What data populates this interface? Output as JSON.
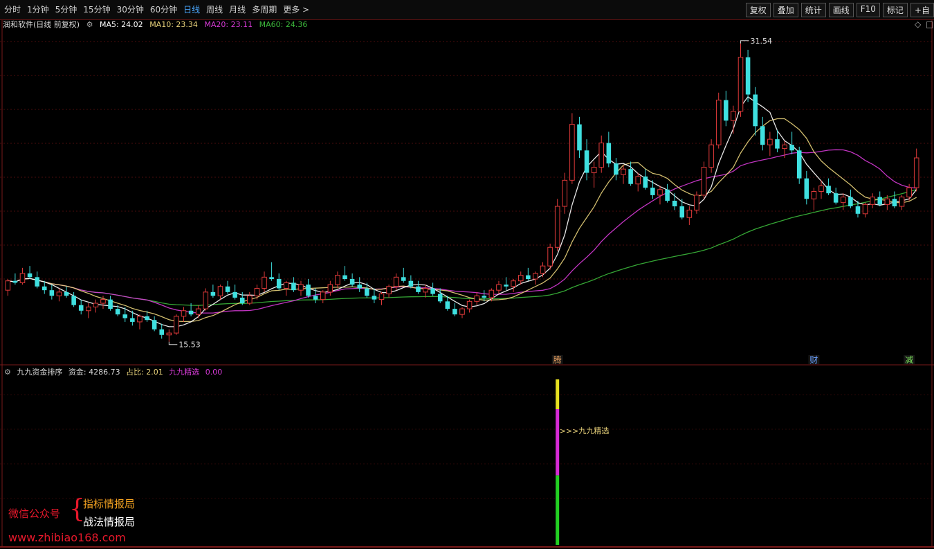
{
  "toolbar": {
    "periods": [
      "分时",
      "1分钟",
      "5分钟",
      "15分钟",
      "30分钟",
      "60分钟",
      "日线",
      "周线",
      "月线",
      "多周期",
      "更多 >"
    ],
    "active_period": "日线",
    "right_buttons": [
      "复权",
      "叠加",
      "统计",
      "画线",
      "F10",
      "标记",
      "+自"
    ]
  },
  "main_info": {
    "title": "润和软件(日线 前复权)",
    "ma5": "MA5: 24.02",
    "ma10": "MA10: 23.34",
    "ma20": "MA20: 23.11",
    "ma60": "MA60: 24.36"
  },
  "annotations": {
    "high": "31.54",
    "low": "15.53"
  },
  "event_markers": [
    {
      "label": "腾",
      "color": "#e8a060"
    },
    {
      "label": "财",
      "color": "#6aa0ff"
    },
    {
      "label": "减",
      "color": "#7adf5a"
    }
  ],
  "sub_info": {
    "name": "九九资金排序",
    "fund": "资金: 4286.73",
    "ratio": "占比: 2.01",
    "pick": "九九精选",
    "pick_value": "0.00"
  },
  "signal_label": ">>>九九精选",
  "watermark": {
    "left": "微信公众号",
    "brace": "{",
    "line1": "指标情报局",
    "line2": "战法情报局",
    "url": "www.zhibiao168.com"
  },
  "colors": {
    "up": "#e03a3a",
    "down": "#3fe0e0",
    "ma5": "#ffffff",
    "ma10": "#e8d27a",
    "ma20": "#d63ad6",
    "ma60": "#3bb83b",
    "grid": "#4a0d0d"
  },
  "chart_data": {
    "type": "candlestick",
    "ohlc": [
      [
        18.3,
        18.9,
        18.0,
        18.8
      ],
      [
        18.8,
        19.2,
        18.6,
        18.7
      ],
      [
        18.7,
        19.5,
        18.6,
        19.2
      ],
      [
        19.2,
        19.6,
        18.9,
        19.0
      ],
      [
        19.0,
        19.3,
        18.4,
        18.5
      ],
      [
        18.5,
        18.8,
        18.1,
        18.3
      ],
      [
        18.3,
        18.6,
        17.8,
        18.0
      ],
      [
        18.0,
        18.4,
        17.7,
        18.2
      ],
      [
        18.2,
        18.5,
        17.9,
        18.0
      ],
      [
        18.0,
        18.2,
        17.4,
        17.5
      ],
      [
        17.5,
        17.8,
        17.0,
        17.2
      ],
      [
        17.2,
        17.6,
        16.8,
        17.4
      ],
      [
        17.4,
        17.8,
        17.1,
        17.6
      ],
      [
        17.6,
        18.0,
        17.3,
        17.8
      ],
      [
        17.8,
        18.0,
        17.2,
        17.3
      ],
      [
        17.3,
        17.5,
        16.9,
        17.0
      ],
      [
        17.0,
        17.4,
        16.6,
        16.8
      ],
      [
        16.8,
        17.2,
        16.4,
        16.6
      ],
      [
        16.6,
        17.0,
        16.2,
        16.9
      ],
      [
        16.9,
        17.2,
        16.6,
        16.7
      ],
      [
        16.7,
        16.9,
        16.1,
        16.2
      ],
      [
        16.2,
        16.5,
        15.7,
        15.9
      ],
      [
        15.9,
        16.2,
        15.53,
        16.0
      ],
      [
        16.0,
        17.0,
        15.9,
        16.9
      ],
      [
        16.9,
        17.4,
        16.6,
        17.2
      ],
      [
        17.2,
        17.6,
        16.9,
        17.0
      ],
      [
        17.0,
        17.5,
        16.8,
        17.3
      ],
      [
        17.3,
        18.4,
        17.2,
        18.2
      ],
      [
        18.2,
        18.6,
        17.9,
        18.0
      ],
      [
        18.0,
        18.6,
        17.8,
        18.5
      ],
      [
        18.5,
        18.8,
        18.1,
        18.2
      ],
      [
        18.2,
        18.6,
        17.8,
        17.9
      ],
      [
        17.9,
        18.2,
        17.5,
        17.6
      ],
      [
        17.6,
        18.2,
        17.5,
        18.0
      ],
      [
        18.0,
        18.6,
        17.8,
        18.4
      ],
      [
        18.4,
        19.3,
        18.2,
        19.0
      ],
      [
        19.0,
        19.8,
        18.8,
        18.9
      ],
      [
        18.9,
        19.2,
        18.3,
        18.4
      ],
      [
        18.4,
        18.8,
        18.0,
        18.7
      ],
      [
        18.7,
        19.0,
        18.2,
        18.3
      ],
      [
        18.3,
        18.8,
        18.0,
        18.6
      ],
      [
        18.6,
        18.9,
        17.9,
        18.0
      ],
      [
        18.0,
        18.4,
        17.6,
        17.8
      ],
      [
        17.8,
        18.3,
        17.6,
        18.2
      ],
      [
        18.2,
        18.8,
        18.0,
        18.6
      ],
      [
        18.6,
        19.3,
        18.4,
        19.1
      ],
      [
        19.1,
        19.6,
        18.8,
        18.9
      ],
      [
        18.9,
        19.2,
        18.5,
        18.6
      ],
      [
        18.6,
        19.0,
        18.2,
        18.4
      ],
      [
        18.4,
        18.7,
        17.9,
        18.0
      ],
      [
        18.0,
        18.4,
        17.6,
        17.8
      ],
      [
        17.8,
        18.2,
        17.5,
        18.1
      ],
      [
        18.1,
        18.6,
        17.9,
        18.5
      ],
      [
        18.5,
        19.2,
        18.3,
        19.0
      ],
      [
        19.0,
        19.5,
        18.7,
        18.8
      ],
      [
        18.8,
        19.1,
        18.4,
        18.5
      ],
      [
        18.5,
        18.8,
        18.1,
        18.2
      ],
      [
        18.2,
        18.6,
        17.9,
        18.4
      ],
      [
        18.4,
        18.7,
        18.0,
        18.1
      ],
      [
        18.1,
        18.4,
        17.6,
        17.7
      ],
      [
        17.7,
        18.0,
        17.2,
        17.3
      ],
      [
        17.3,
        17.6,
        16.9,
        17.0
      ],
      [
        17.0,
        17.4,
        16.8,
        17.3
      ],
      [
        17.3,
        17.8,
        17.1,
        17.7
      ],
      [
        17.7,
        18.2,
        17.5,
        18.0
      ],
      [
        18.0,
        18.3,
        17.7,
        17.9
      ],
      [
        17.9,
        18.4,
        17.7,
        18.3
      ],
      [
        18.3,
        18.8,
        18.1,
        18.6
      ],
      [
        18.6,
        19.0,
        18.3,
        18.5
      ],
      [
        18.5,
        18.9,
        18.2,
        18.8
      ],
      [
        18.8,
        19.3,
        18.6,
        19.1
      ],
      [
        19.1,
        19.5,
        18.8,
        18.9
      ],
      [
        18.9,
        19.3,
        18.6,
        19.2
      ],
      [
        19.2,
        19.8,
        19.0,
        19.6
      ],
      [
        19.6,
        20.8,
        19.4,
        20.6
      ],
      [
        20.6,
        23.2,
        20.4,
        22.8
      ],
      [
        22.8,
        24.6,
        22.4,
        24.2
      ],
      [
        24.2,
        27.8,
        24.0,
        27.2
      ],
      [
        27.2,
        27.6,
        25.4,
        25.8
      ],
      [
        25.8,
        26.4,
        24.2,
        24.6
      ],
      [
        24.6,
        25.2,
        23.8,
        24.9
      ],
      [
        24.9,
        26.6,
        24.6,
        26.2
      ],
      [
        26.2,
        26.8,
        24.9,
        25.1
      ],
      [
        25.1,
        25.4,
        24.2,
        24.5
      ],
      [
        24.5,
        25.0,
        24.0,
        24.8
      ],
      [
        24.8,
        25.2,
        23.9,
        24.0
      ],
      [
        24.0,
        24.6,
        23.6,
        24.4
      ],
      [
        24.4,
        24.8,
        23.7,
        23.8
      ],
      [
        23.8,
        24.2,
        23.2,
        23.4
      ],
      [
        23.4,
        23.9,
        22.9,
        23.7
      ],
      [
        23.7,
        24.0,
        23.0,
        23.1
      ],
      [
        23.1,
        23.5,
        22.6,
        22.8
      ],
      [
        22.8,
        23.2,
        22.1,
        22.2
      ],
      [
        22.2,
        22.8,
        21.8,
        22.6
      ],
      [
        22.6,
        23.6,
        22.4,
        23.4
      ],
      [
        23.4,
        25.2,
        23.2,
        24.9
      ],
      [
        24.9,
        26.4,
        24.6,
        26.1
      ],
      [
        26.1,
        28.9,
        25.9,
        28.5
      ],
      [
        28.5,
        29.0,
        27.1,
        27.4
      ],
      [
        27.4,
        28.2,
        26.7,
        27.9
      ],
      [
        27.9,
        31.54,
        27.6,
        30.8
      ],
      [
        30.8,
        31.2,
        28.4,
        28.8
      ],
      [
        28.8,
        29.2,
        26.6,
        27.1
      ],
      [
        27.1,
        27.6,
        25.8,
        26.1
      ],
      [
        26.1,
        26.8,
        25.5,
        26.4
      ],
      [
        26.4,
        26.9,
        25.7,
        25.9
      ],
      [
        25.9,
        26.3,
        25.4,
        26.1
      ],
      [
        26.1,
        26.8,
        25.6,
        25.8
      ],
      [
        25.8,
        26.0,
        24.0,
        24.3
      ],
      [
        24.3,
        24.7,
        22.9,
        23.2
      ],
      [
        23.2,
        23.8,
        22.6,
        23.6
      ],
      [
        23.6,
        24.2,
        23.2,
        23.9
      ],
      [
        23.9,
        24.3,
        23.4,
        23.5
      ],
      [
        23.5,
        23.8,
        22.9,
        23.0
      ],
      [
        23.0,
        23.5,
        22.6,
        23.3
      ],
      [
        23.3,
        23.7,
        22.7,
        22.8
      ],
      [
        22.8,
        23.1,
        22.2,
        22.4
      ],
      [
        22.4,
        23.0,
        22.2,
        22.9
      ],
      [
        22.9,
        23.5,
        22.7,
        23.3
      ],
      [
        23.3,
        23.6,
        22.8,
        22.9
      ],
      [
        22.9,
        23.4,
        22.6,
        23.2
      ],
      [
        23.2,
        23.6,
        22.7,
        22.8
      ],
      [
        22.8,
        23.4,
        22.6,
        23.3
      ],
      [
        23.3,
        24.0,
        23.1,
        23.8
      ],
      [
        23.8,
        25.9,
        23.6,
        25.4
      ]
    ],
    "ma_labels": [
      "MA5",
      "MA10",
      "MA20",
      "MA60"
    ],
    "high_label": "31.54",
    "low_label": "15.53",
    "indicator": {
      "name": "九九资金排序",
      "fund": 4286.73,
      "ratio": 2.01,
      "pick": 0.0,
      "signal_index": 75,
      "signal_segments": [
        {
          "color": "#e6e020",
          "fraction": 0.18
        },
        {
          "color": "#d62ad6",
          "fraction": 0.4
        },
        {
          "color": "#22d022",
          "fraction": 0.42
        }
      ]
    }
  }
}
